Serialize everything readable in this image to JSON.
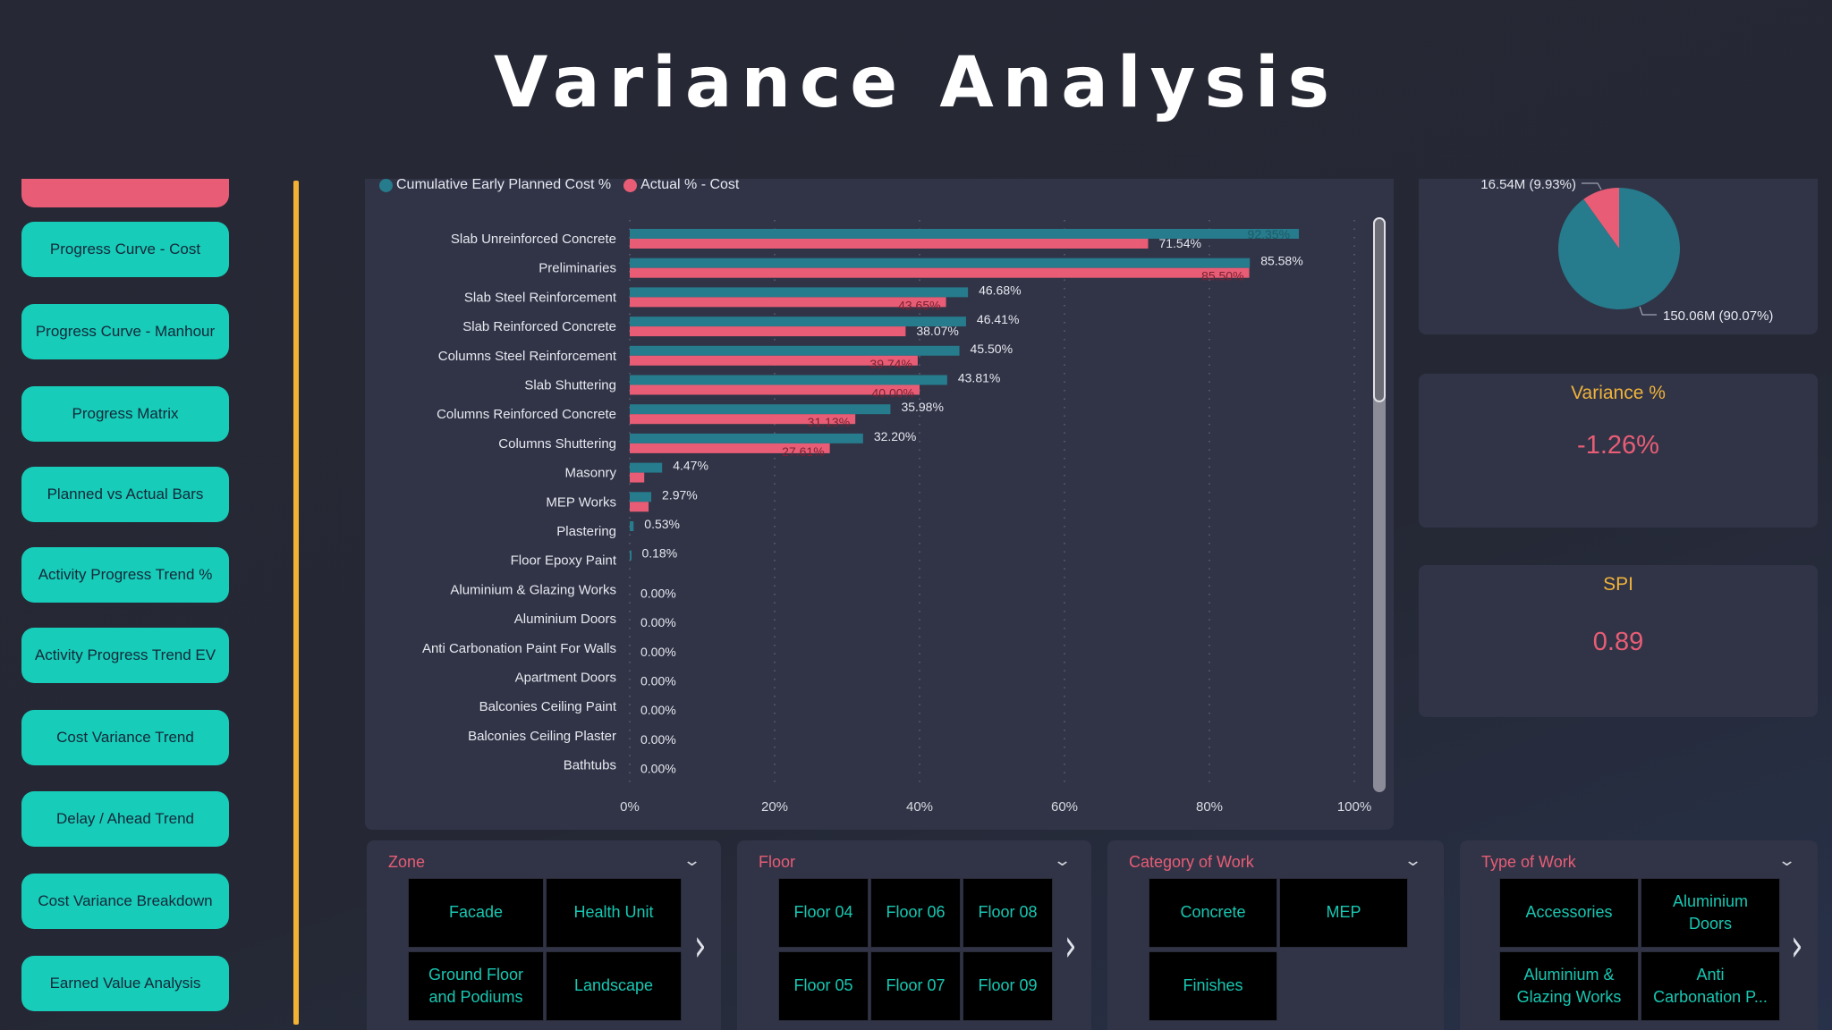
{
  "header": {
    "title": "Variance Analysis"
  },
  "colors": {
    "planned": "#267b8c",
    "actual": "#e85d75",
    "nav_button": "#17ccb8",
    "nav_active": "#e85d75",
    "accent_line": "#f2b233",
    "kpi_title": "#f0b33a",
    "kpi_value": "#e85d75",
    "slicer_title": "#e85d75",
    "tile_text": "#17c8b3"
  },
  "sidebar": {
    "items": [
      {
        "label": "",
        "active": true
      },
      {
        "label": "Progress Curve - Cost"
      },
      {
        "label": "Progress Curve - Manhour"
      },
      {
        "label": "Progress Matrix"
      },
      {
        "label": "Planned vs Actual Bars"
      },
      {
        "label": "Activity Progress Trend %"
      },
      {
        "label": "Activity Progress Trend EV"
      },
      {
        "label": "Cost Variance Trend"
      },
      {
        "label": "Delay / Ahead Trend"
      },
      {
        "label": "Cost Variance Breakdown"
      },
      {
        "label": "Earned Value Analysis"
      }
    ]
  },
  "chart_data": [
    {
      "type": "bar",
      "orientation": "horizontal",
      "title": "",
      "legend": {
        "position": "top-left",
        "entries": [
          "Cumulative Early Planned Cost %",
          "Actual % - Cost"
        ]
      },
      "categories": [
        "Slab Unreinforced Concrete",
        "Preliminaries",
        "Slab Steel Reinforcement",
        "Slab Reinforced Concrete",
        "Columns Steel Reinforcement",
        "Slab Shuttering",
        "Columns Reinforced Concrete",
        "Columns Shuttering",
        "Masonry",
        "MEP Works",
        "Plastering",
        "Floor Epoxy Paint",
        "Aluminium & Glazing Works",
        "Aluminium Doors",
        "Anti Carbonation Paint For Walls",
        "Apartment Doors",
        "Balconies Ceiling Paint",
        "Balconies Ceiling Plaster",
        "Bathtubs"
      ],
      "series": [
        {
          "name": "Cumulative Early Planned Cost %",
          "values": [
            92.35,
            85.58,
            46.68,
            46.41,
            45.5,
            43.81,
            35.98,
            32.2,
            4.47,
            2.97,
            0.53,
            0.18,
            0.0,
            0.0,
            0.0,
            0.0,
            0.0,
            0.0,
            0.0
          ],
          "labels": [
            "92.35%",
            "85.58%",
            "46.68%",
            "46.41%",
            "45.50%",
            "43.81%",
            "35.98%",
            "32.20%",
            "4.47%",
            "2.97%",
            "0.53%",
            "0.18%",
            "0.00%",
            "0.00%",
            "0.00%",
            "0.00%",
            "0.00%",
            "0.00%",
            "0.00%"
          ]
        },
        {
          "name": "Actual % - Cost",
          "values": [
            71.54,
            85.5,
            43.65,
            38.07,
            39.74,
            40.0,
            31.13,
            27.61,
            2.0,
            2.6,
            null,
            null,
            null,
            null,
            null,
            null,
            null,
            null,
            null
          ],
          "labels": [
            "71.54%",
            "85.50%",
            "43.65%",
            "38.07%",
            "39.74%",
            "40.00%",
            "31.13%",
            "27.61%",
            "",
            "",
            "",
            "",
            "",
            "",
            "",
            "",
            "",
            "",
            ""
          ]
        }
      ],
      "xlabel": "",
      "ylabel": "",
      "xlim": [
        0,
        100
      ],
      "xticks": [
        "0%",
        "20%",
        "40%",
        "60%",
        "80%",
        "100%"
      ],
      "grid": true
    },
    {
      "type": "pie",
      "slices": [
        {
          "label": "16.54M (9.93%)",
          "value": 16.54,
          "percent": 9.93
        },
        {
          "label": "150.06M (90.07%)",
          "value": 150.06,
          "percent": 90.07
        }
      ]
    }
  ],
  "kpis": [
    {
      "title": "Variance %",
      "value": "-1.26%"
    },
    {
      "title": "SPI",
      "value": "0.89"
    }
  ],
  "slicers": [
    {
      "title": "Zone",
      "tiles": [
        "Facade",
        "Health Unit",
        "Ground Floor and Podiums",
        "Landscape"
      ]
    },
    {
      "title": "Floor",
      "tiles": [
        "Floor 04",
        "Floor 06",
        "Floor 08",
        "Floor 05",
        "Floor 07",
        "Floor 09"
      ]
    },
    {
      "title": "Category of Work",
      "tiles": [
        "Concrete",
        "MEP",
        "Finishes"
      ]
    },
    {
      "title": "Type of Work",
      "tiles": [
        "Accessories",
        "Aluminium Doors",
        "Aluminium & Glazing Works",
        "Anti Carbonation P..."
      ]
    }
  ],
  "icons": {
    "chevron_down": "⌄",
    "chevron_right": "›"
  }
}
